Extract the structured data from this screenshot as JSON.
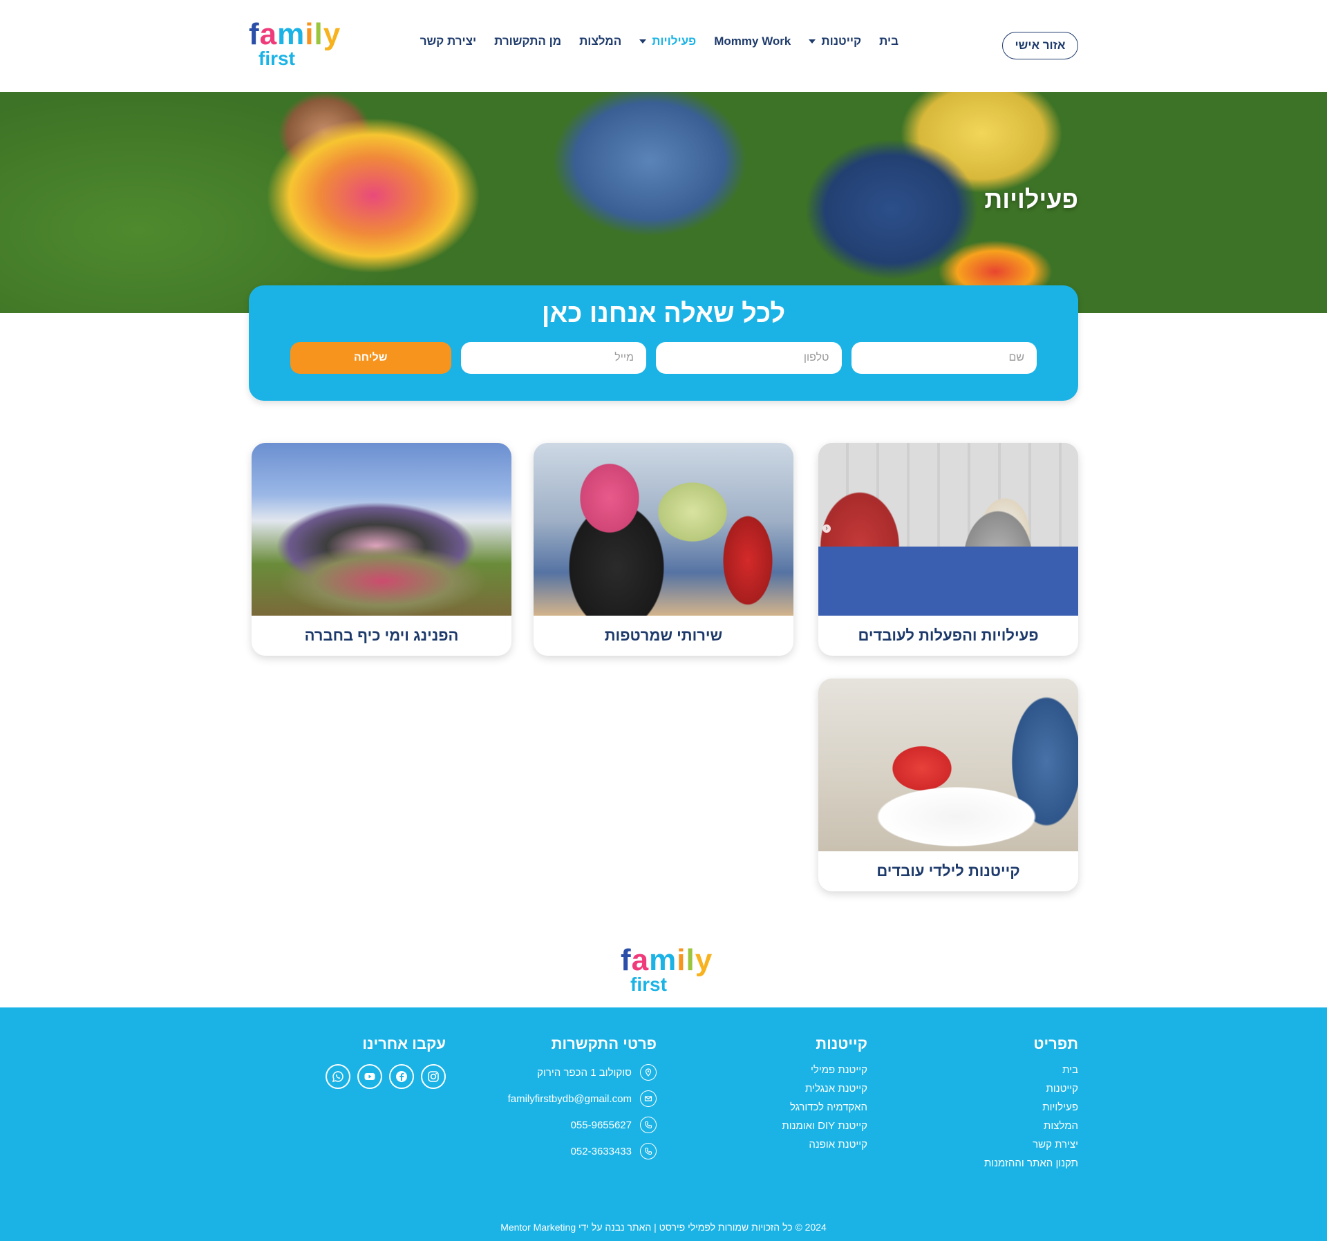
{
  "logo": {
    "word1": [
      "f",
      "a",
      "m",
      "i",
      "l",
      "y"
    ],
    "word2": "first"
  },
  "nav": {
    "items": [
      {
        "label": "בית",
        "dropdown": false
      },
      {
        "label": "קייטנות",
        "dropdown": true
      },
      {
        "label": "Mommy Work",
        "dropdown": false
      },
      {
        "label": "פעילויות",
        "dropdown": true,
        "active": true
      },
      {
        "label": "המלצות",
        "dropdown": false
      },
      {
        "label": "מן התקשורת",
        "dropdown": false
      },
      {
        "label": "יצירת קשר",
        "dropdown": false
      }
    ],
    "personal_area": "אזור אישי"
  },
  "hero": {
    "title": "פעילויות"
  },
  "contact_form": {
    "title": "לכל שאלה אנחנו כאן",
    "name_placeholder": "שם",
    "phone_placeholder": "טלפון",
    "email_placeholder": "מייל",
    "submit_label": "שליחה"
  },
  "cards": [
    {
      "title": "פעילויות והפעלות לעובדים"
    },
    {
      "title": "שירותי שמרטפות"
    },
    {
      "title": "הפנינג וימי כיף בחברה"
    },
    {
      "title": "קייטנות לילדי עובדים"
    }
  ],
  "footer": {
    "menu_title": "תפריט",
    "menu_items": [
      "בית",
      "קייטנות",
      "פעילויות",
      "המלצות",
      "יצירת קשר",
      "תקנון האתר וההזמנות"
    ],
    "camps_title": "קייטנות",
    "camps_items": [
      "קייטנת פמילי",
      "קייטנת אנגלית",
      "האקדמיה לכדורגל",
      "קייטנת DIY ואומנות",
      "קייטנת אופנה"
    ],
    "contact_title": "פרטי התקשרות",
    "address": "סוקולוב 1 הכפר הירוק",
    "email": "familyfirstbydb@gmail.com",
    "phone1": "055-9655627",
    "phone2": "052-3633433",
    "follow_title": "עקבו אחרינו",
    "social_icons": [
      "whatsapp-icon",
      "youtube-icon",
      "facebook-icon",
      "instagram-icon"
    ],
    "copyright": "2024 © כל הזכויות שמורות לפמילי פירסט | האתר נבנה על ידי Mentor Marketing"
  },
  "colors": {
    "primary": "#1bb3e6",
    "accent": "#f7941d",
    "navy": "#1d3a6b"
  }
}
